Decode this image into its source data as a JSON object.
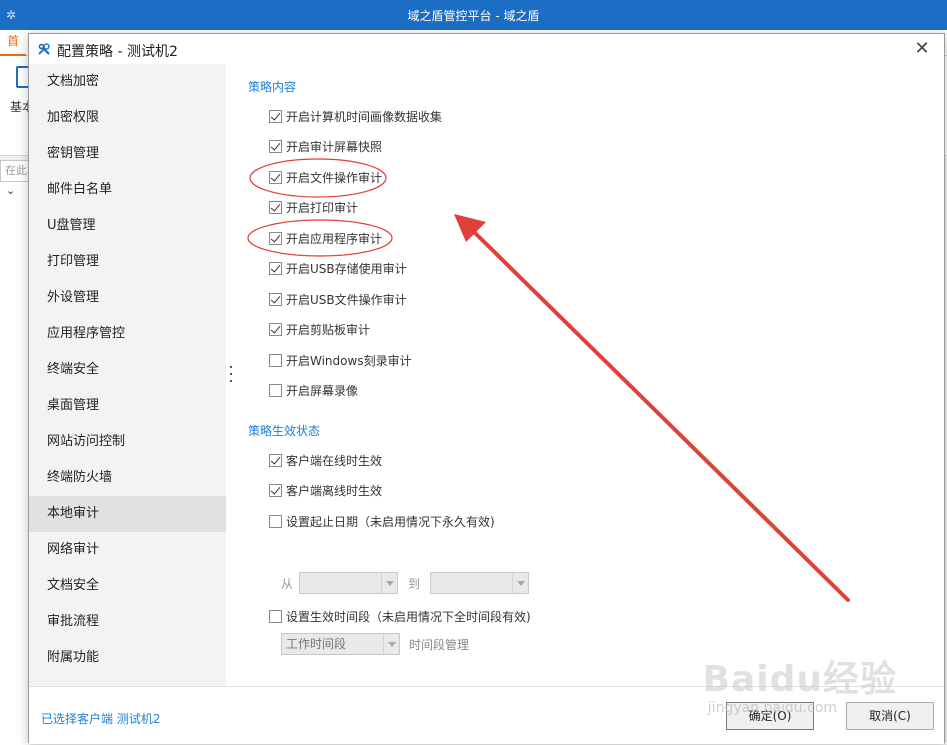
{
  "app": {
    "title": "域之盾管控平台 - 域之盾",
    "tab_first": "首",
    "ribbon_label": "基本",
    "search_placeholder": "在此"
  },
  "dialog": {
    "title": "配置策略 - 测试机2",
    "close_glyph": "✕",
    "nav": [
      "文档加密",
      "加密权限",
      "密钥管理",
      "邮件白名单",
      "U盘管理",
      "打印管理",
      "外设管理",
      "应用程序管控",
      "终端安全",
      "桌面管理",
      "网站访问控制",
      "终端防火墙",
      "本地审计",
      "网络审计",
      "文档安全",
      "审批流程",
      "附属功能"
    ],
    "active_nav": "本地审计",
    "section_policy_title": "策略内容",
    "policy_options": [
      {
        "label": "开启计算机时间画像数据收集",
        "checked": true
      },
      {
        "label": "开启审计屏幕快照",
        "checked": true
      },
      {
        "label": "开启文件操作审计",
        "checked": true
      },
      {
        "label": "开启打印审计",
        "checked": true
      },
      {
        "label": "开启应用程序审计",
        "checked": true
      },
      {
        "label": "开启USB存储使用审计",
        "checked": true
      },
      {
        "label": "开启USB文件操作审计",
        "checked": true
      },
      {
        "label": "开启剪贴板审计",
        "checked": true
      },
      {
        "label": "开启Windows刻录审计",
        "checked": false
      },
      {
        "label": "开启屏幕录像",
        "checked": false
      }
    ],
    "section_status_title": "策略生效状态",
    "status_options": [
      {
        "label": "客户端在线时生效",
        "checked": true
      },
      {
        "label": "客户端离线时生效",
        "checked": true
      },
      {
        "label": "设置起止日期（未启用情况下永久有效)",
        "checked": false
      }
    ],
    "date_from_label": "从",
    "date_to_label": "到",
    "time_option": {
      "label": "设置生效时间段（未启用情况下全时间段有效)",
      "checked": false
    },
    "time_combo_value": "工作时间段",
    "time_manage_label": "时间段管理",
    "footer_info": "已选择客户端 测试机2",
    "ok_label": "确定(O)",
    "cancel_label": "取消(C)"
  },
  "annotation": {
    "color": "#e0403a",
    "watermark": "Baidu经验",
    "watermark_sub": "jingyan.baidu.com"
  },
  "colors": {
    "app_titlebar": "#1c6dc4",
    "accent_blue": "#1f7fd6",
    "nav_bg": "#f3f3f3",
    "nav_active": "#e1e1e1"
  }
}
